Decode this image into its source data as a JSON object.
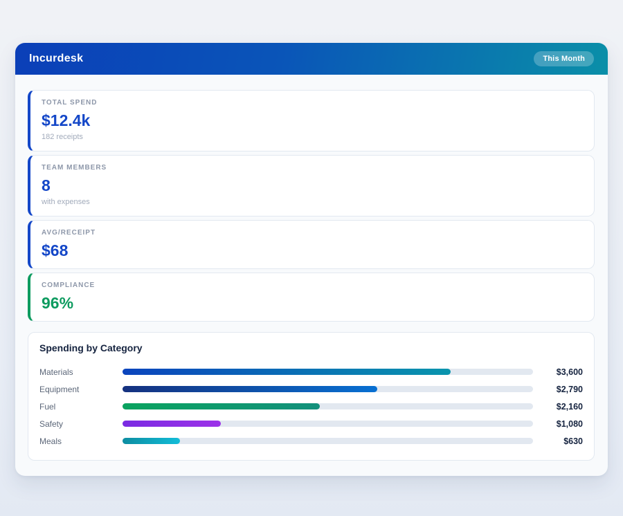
{
  "header": {
    "title": "Incurdesk",
    "badge": "This Month"
  },
  "stats": [
    {
      "label": "TOTAL SPEND",
      "value": "$12.4k",
      "sub": "182 receipts",
      "accent": "#1447c8",
      "value_color": "#1447c8"
    },
    {
      "label": "TEAM MEMBERS",
      "value": "8",
      "sub": "with expenses",
      "accent": "#1447c8",
      "value_color": "#1447c8"
    },
    {
      "label": "AVG/RECEIPT",
      "value": "$68",
      "sub": "",
      "accent": "#1447c8",
      "value_color": "#1447c8"
    },
    {
      "label": "COMPLIANCE",
      "value": "96%",
      "sub": "",
      "accent": "#0d9b5f",
      "value_color": "#0d9b5f"
    }
  ],
  "chart_data": {
    "type": "bar",
    "orientation": "horizontal",
    "title": "Spending by Category",
    "categories": [
      "Materials",
      "Equipment",
      "Fuel",
      "Safety",
      "Meals"
    ],
    "values": [
      3600,
      2790,
      2160,
      1080,
      630
    ],
    "value_labels": [
      "$3,600",
      "$2,790",
      "$2,160",
      "$1,080",
      "$630"
    ],
    "xlim": [
      0,
      4500
    ],
    "percents": [
      80,
      62,
      48,
      24,
      14
    ],
    "bar_colors": [
      [
        "#0b44bd",
        "#0a95ad"
      ],
      [
        "#15317f",
        "#0870d2"
      ],
      [
        "#0aa35f",
        "#13907c"
      ],
      [
        "#7a2be2",
        "#9c32e8"
      ],
      [
        "#0d8da1",
        "#12bcd8"
      ]
    ],
    "track_color": "#e2e8f0",
    "grid": false,
    "legend": false
  },
  "colors": {
    "header_gradient_start": "#0b3fb8",
    "header_gradient_end": "#0a8fa8",
    "badge_bg": "rgba(255,255,255,0.24)",
    "accent_blue": "#1447c8",
    "accent_green": "#0d9b5f",
    "page_bg": "#edf0f5",
    "card_border": "#e2e8f0"
  }
}
